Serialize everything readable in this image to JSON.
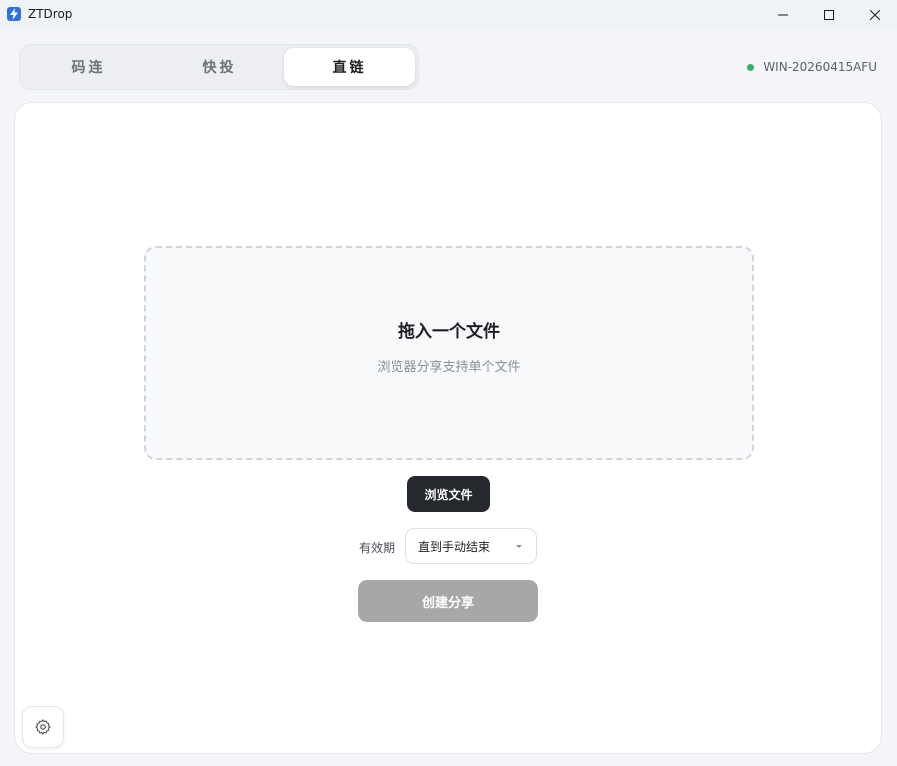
{
  "window": {
    "title": "ZTDrop",
    "icon": "lightning-icon",
    "accent": "#2f6fe0"
  },
  "modes": {
    "tabs": [
      {
        "label": "码连",
        "active": false
      },
      {
        "label": "快投",
        "active": false
      },
      {
        "label": "直链",
        "active": true
      }
    ]
  },
  "device": {
    "name": "WIN-20260415AFU",
    "status_color": "#2eb36a"
  },
  "dropzone": {
    "title": "拖入一个文件",
    "subtitle": "浏览器分享支持单个文件"
  },
  "actions": {
    "browse_label": "浏览文件",
    "expiry_label": "有效期",
    "expiry_value": "直到手动结束",
    "create_label": "创建分享"
  },
  "icons": {
    "settings": "gear-icon"
  }
}
